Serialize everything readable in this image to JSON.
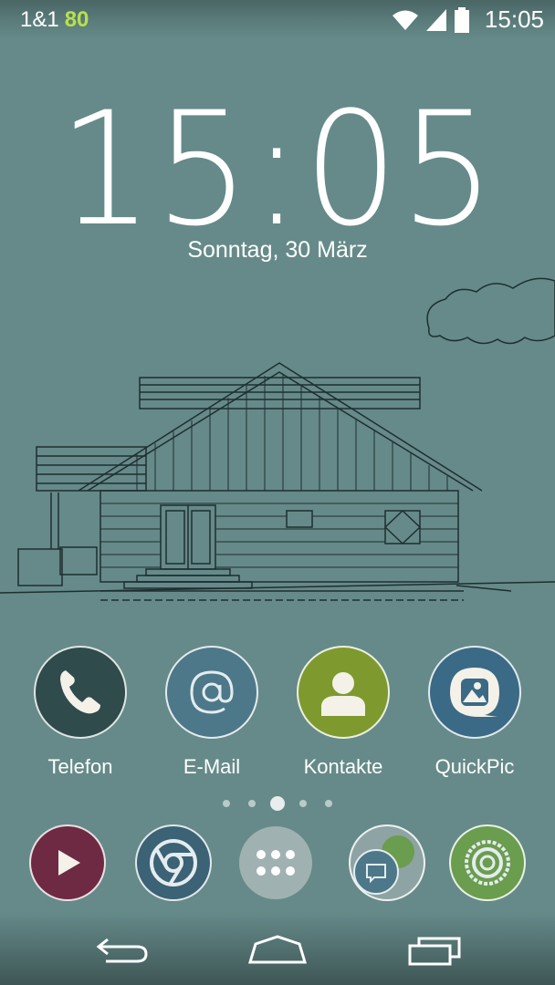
{
  "status_bar": {
    "carrier": "1&1",
    "badge": "80",
    "time": "15:05",
    "icons": [
      "wifi-icon",
      "signal-icon",
      "battery-icon"
    ]
  },
  "clock": {
    "time": "15:05",
    "date": "Sonntag, 30 März"
  },
  "apps": [
    {
      "label": "Telefon",
      "icon": "phone-icon",
      "color": "#2f4b4c"
    },
    {
      "label": "E-Mail",
      "icon": "at-icon",
      "color": "#4d7889"
    },
    {
      "label": "Kontakte",
      "icon": "contact-icon",
      "color": "#7e9a2e"
    },
    {
      "label": "QuickPic",
      "icon": "quickpic-icon",
      "color": "#3a6a86"
    }
  ],
  "page_indicator": {
    "count": 5,
    "active": 2
  },
  "dock": [
    {
      "icon": "play-store-icon",
      "color": "#6e2a42"
    },
    {
      "icon": "chrome-icon",
      "color": "#3b6275"
    },
    {
      "icon": "app-drawer-icon",
      "color": "#9fb2b1"
    },
    {
      "icon": "messaging-icon",
      "color": "#8ea3a3"
    },
    {
      "icon": "camera-icon",
      "color": "#6a9d4e"
    }
  ],
  "navigation": [
    "back-icon",
    "home-icon",
    "recent-apps-icon"
  ]
}
